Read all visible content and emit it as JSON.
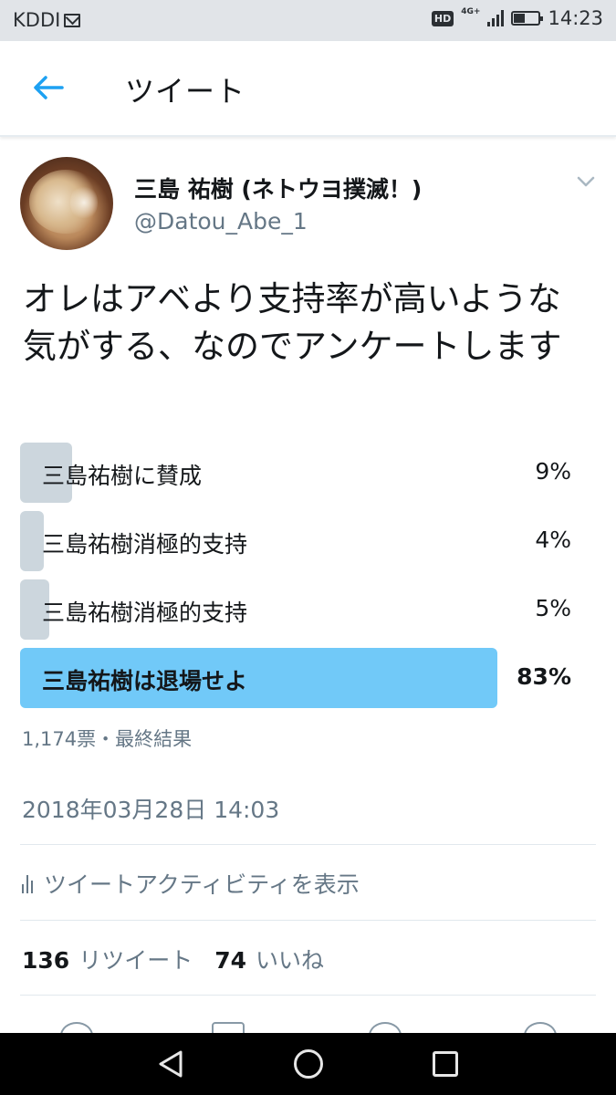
{
  "status_bar": {
    "carrier": "KDDI",
    "hd": "HD",
    "network": "4G+",
    "time": "14:23"
  },
  "header": {
    "title": "ツイート"
  },
  "tweet": {
    "display_name": "三島 祐樹 (ネトウヨ撲滅！)",
    "username": "@Datou_Abe_1",
    "text": "オレはアベより支持率が高いような気がする、なのでアンケートします",
    "poll": {
      "options": [
        {
          "label": "三島祐樹に賛成",
          "percent_text": "9%",
          "percent": 9,
          "winner": false
        },
        {
          "label": "三島祐樹消極的支持",
          "percent_text": "4%",
          "percent": 4,
          "winner": false
        },
        {
          "label": "三島祐樹消極的支持",
          "percent_text": "5%",
          "percent": 5,
          "winner": false
        },
        {
          "label": "三島祐樹は退場せよ",
          "percent_text": "83%",
          "percent": 83,
          "winner": true
        }
      ],
      "meta": "1,174票・最終結果"
    },
    "timestamp": "2018年03月28日 14:03",
    "activity_label": "ツイートアクティビティを表示",
    "retweet_count": "136",
    "retweet_label": "リツイート",
    "like_count": "74",
    "like_label": "いいね"
  },
  "colors": {
    "accent": "#1da1f2",
    "poll_winner": "#71c9f8",
    "poll_other": "#ccd6dd",
    "secondary_text": "#657786"
  },
  "icons": {
    "back": "back-arrow-icon",
    "caret": "chevron-down-icon",
    "activity": "bar-chart-icon"
  }
}
